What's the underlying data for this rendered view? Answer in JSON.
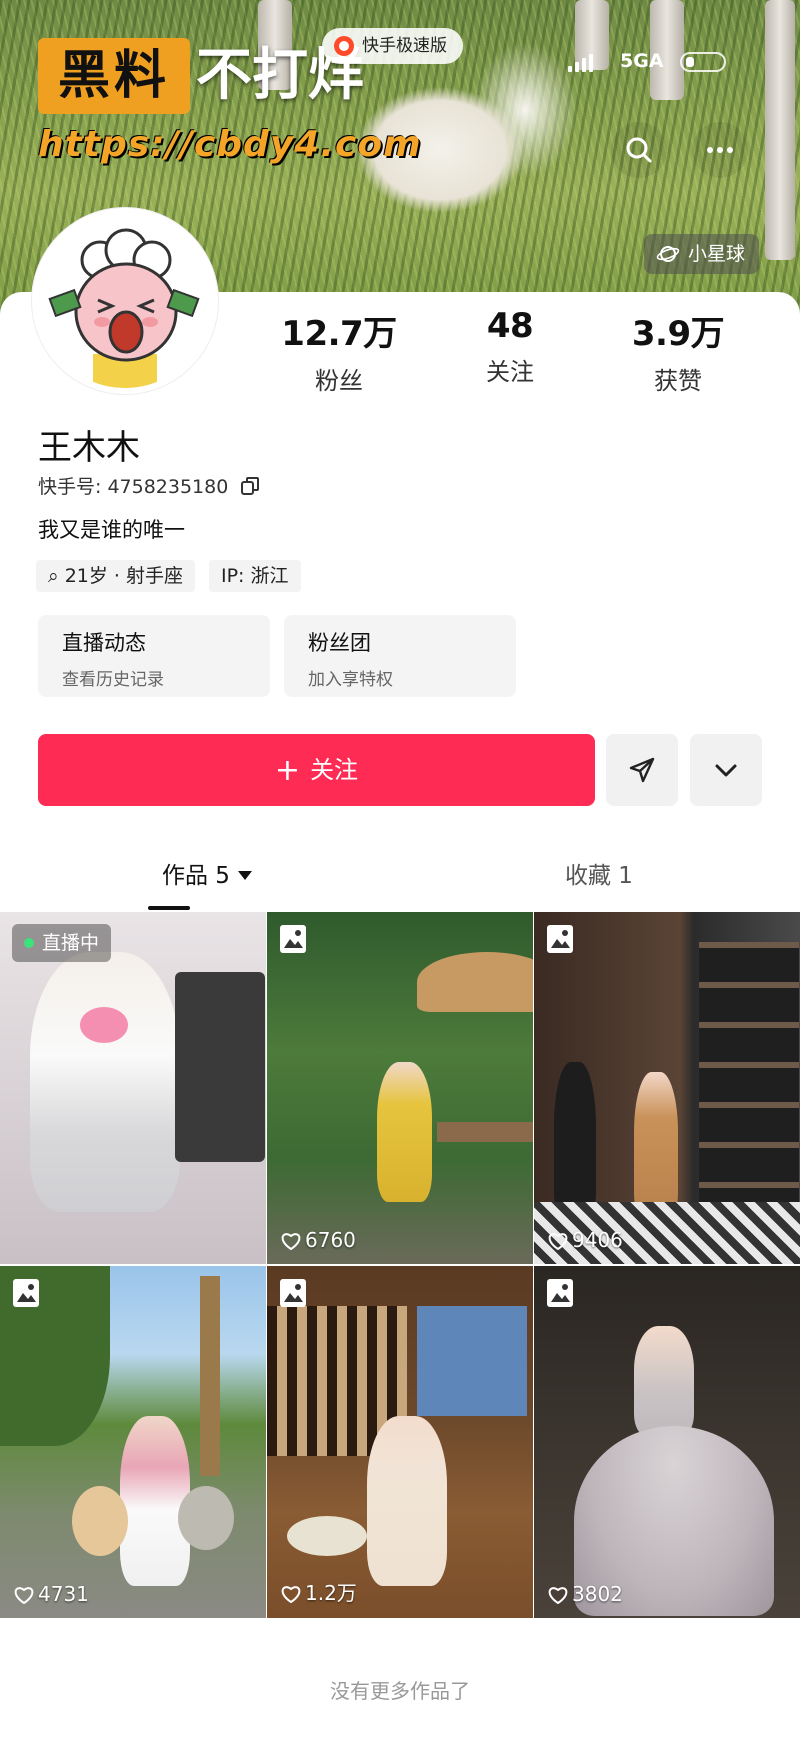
{
  "watermark": {
    "brand": "黑料",
    "slogan": "不打烊",
    "url": "https://cbdy4.com"
  },
  "status_bar": {
    "network": "5GA"
  },
  "app_badge": "快手极速版",
  "planet_chip": "小星球",
  "profile": {
    "stats": [
      {
        "value": "12.7万",
        "label": "粉丝"
      },
      {
        "value": "48",
        "label": "关注"
      },
      {
        "value": "3.9万",
        "label": "获赞"
      }
    ],
    "name": "王木木",
    "uid": "快手号: 4758235180",
    "bio": "我又是谁的唯一",
    "tags": [
      "21岁 · 射手座",
      "IP: 浙江"
    ],
    "cards": [
      {
        "title": "直播动态",
        "subtitle": "查看历史记录"
      },
      {
        "title": "粉丝团",
        "subtitle": "加入享特权"
      }
    ],
    "follow_label": "关注"
  },
  "tabs": [
    {
      "label": "作品 5",
      "active": true
    },
    {
      "label": "收藏 1",
      "active": false
    }
  ],
  "posts": [
    {
      "type": "live",
      "badge": "直播中",
      "likes": ""
    },
    {
      "type": "image",
      "badge": "",
      "likes": "6760"
    },
    {
      "type": "image",
      "badge": "",
      "likes": "9406"
    },
    {
      "type": "image",
      "badge": "",
      "likes": "4731"
    },
    {
      "type": "image",
      "badge": "",
      "likes": "1.2万"
    },
    {
      "type": "image",
      "badge": "",
      "likes": "3802"
    }
  ],
  "footer_note": "没有更多作品了",
  "colors": {
    "accent": "#fe2c55",
    "live_dot": "#3ce27a"
  },
  "icons": [
    "search-icon",
    "more-icon",
    "planet-icon",
    "copy-icon",
    "send-icon",
    "chevron-down-icon",
    "image-icon",
    "heart-icon"
  ]
}
